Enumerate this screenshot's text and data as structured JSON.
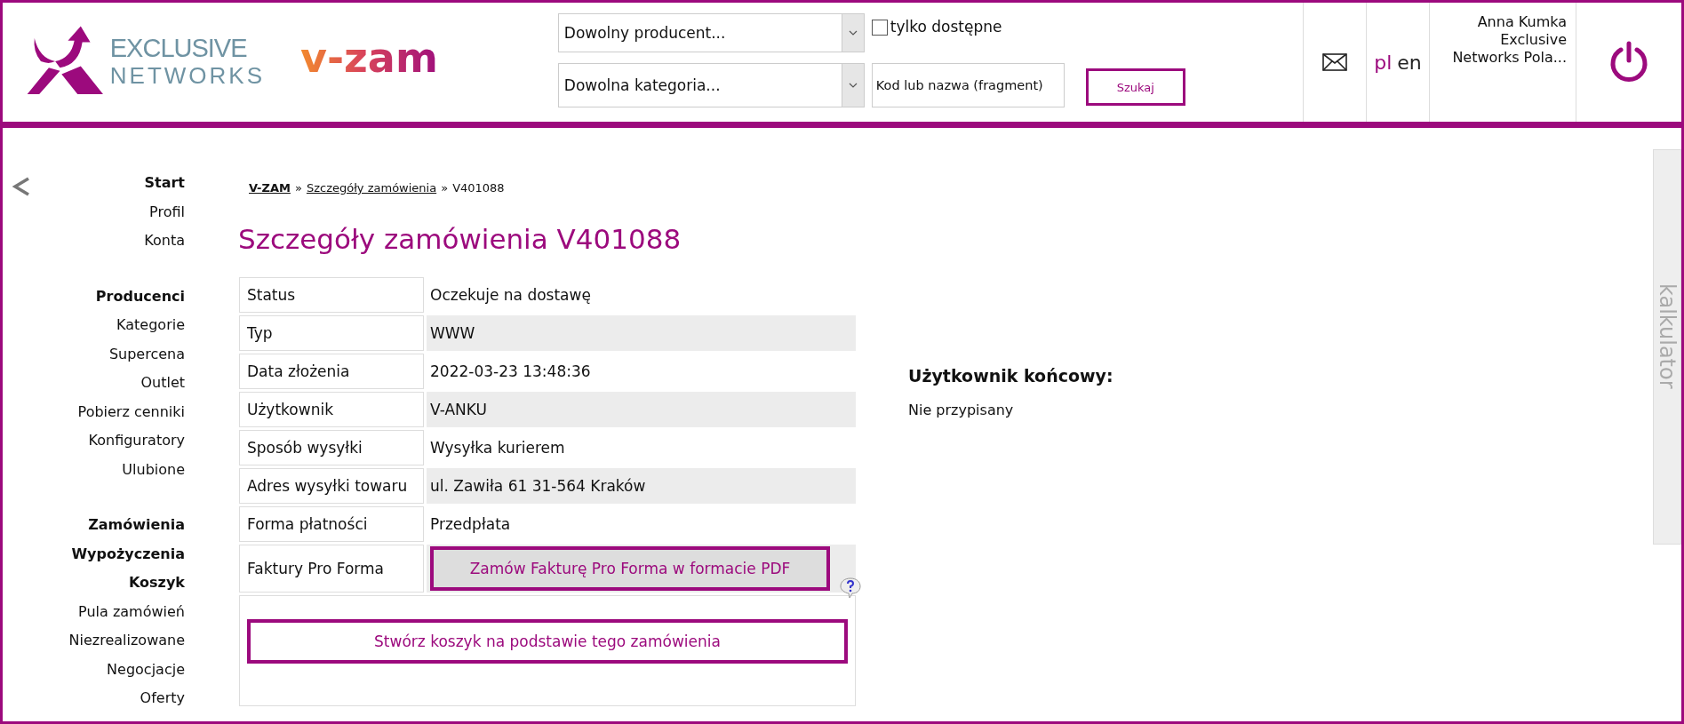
{
  "header": {
    "logo": {
      "line1": "EXCLUSIVE",
      "line2": "NETWORKS"
    },
    "app_logo": "v-zam",
    "producer_select": {
      "value": "Dowolny producent..."
    },
    "category_select": {
      "value": "Dowolna kategoria..."
    },
    "only_available": {
      "label": "tylko dostępne",
      "checked": false
    },
    "search": {
      "value": "Kod lub nazwa (fragment)"
    },
    "search_button": "Szukaj",
    "languages": [
      {
        "label": "pl",
        "selected": true
      },
      {
        "label": "en",
        "selected": false
      }
    ],
    "user": {
      "name": "Anna Kumka",
      "company_lines": [
        "Exclusive",
        "Networks Pola..."
      ]
    }
  },
  "sidebar": {
    "groups": [
      {
        "items": [
          {
            "label": "Start",
            "kind": "main"
          },
          {
            "label": "Profil",
            "kind": "sub"
          },
          {
            "label": "Konta",
            "kind": "sub"
          }
        ]
      },
      {
        "items": [
          {
            "label": "Producenci",
            "kind": "main"
          },
          {
            "label": "Kategorie",
            "kind": "sub"
          },
          {
            "label": "Supercena",
            "kind": "sub"
          },
          {
            "label": "Outlet",
            "kind": "sub"
          },
          {
            "label": "Pobierz cenniki",
            "kind": "sub"
          },
          {
            "label": "Konfiguratory",
            "kind": "sub"
          },
          {
            "label": "Ulubione",
            "kind": "sub"
          }
        ]
      },
      {
        "items": [
          {
            "label": "Zamówienia",
            "kind": "main"
          },
          {
            "label": "Wypożyczenia",
            "kind": "main"
          },
          {
            "label": "Koszyk",
            "kind": "main"
          },
          {
            "label": "Pula zamówień",
            "kind": "sub"
          },
          {
            "label": "Niezrealizowane",
            "kind": "sub"
          },
          {
            "label": "Negocjacje",
            "kind": "sub"
          },
          {
            "label": "Oferty",
            "kind": "sub"
          }
        ]
      }
    ]
  },
  "breadcrumb": [
    {
      "label": "V-ZAM",
      "kind": "root"
    },
    {
      "label": "Szczegóły zamówienia",
      "kind": "link"
    },
    {
      "label": "V401088",
      "kind": "current"
    }
  ],
  "breadcrumb_separator": "»",
  "title": "Szczegóły zamówienia V401088",
  "details": [
    {
      "label": "Status",
      "kind": "text",
      "value": "Oczekuje na dostawę"
    },
    {
      "label": "Typ",
      "kind": "text",
      "value": "WWW"
    },
    {
      "label": "Data złożenia",
      "kind": "text",
      "value": "2022-03-23 13:48:36"
    },
    {
      "label": "Użytkownik",
      "kind": "text",
      "value": "V-ANKU"
    },
    {
      "label": "Sposób wysyłki",
      "kind": "text",
      "value": "Wysyłka kurierem"
    },
    {
      "label": "Adres wysyłki towaru",
      "kind": "text",
      "value": "ul. Zawiła 61 31-564 Kraków"
    },
    {
      "label": "Forma płatności",
      "kind": "text",
      "value": "Przedpłata"
    },
    {
      "label": "Faktury Pro Forma",
      "kind": "action",
      "value": "Zamów Fakturę Pro Forma w formacie PDF"
    }
  ],
  "create_cart_button": "Stwórz koszyk na podstawie tego zamówienia",
  "end_user": {
    "heading": "Użytkownik końcowy:",
    "value": "Nie przypisany"
  },
  "calculator_tab": "kalkulator"
}
